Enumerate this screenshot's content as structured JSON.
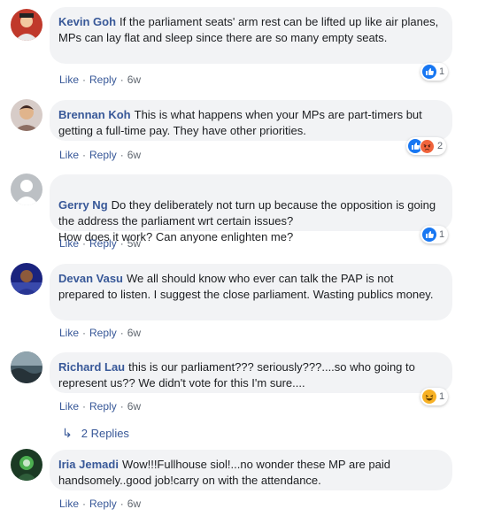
{
  "action_labels": {
    "like": "Like",
    "reply": "Reply"
  },
  "comments": [
    {
      "author": "Kevin Goh",
      "text": "If the parliament seats' arm rest can be lifted up like air planes, MPs can lay flat and sleep since there are so many empty seats.",
      "time": "6w",
      "reaction_icons": [
        "like-icon"
      ],
      "reaction_count": "1",
      "avatar_color": "#c0392b"
    },
    {
      "author": "Brennan Koh",
      "text": "This is what happens when your MPs are part-timers but getting a full-time pay. They have other priorities.",
      "time": "6w",
      "reaction_icons": [
        "like-icon",
        "angry-icon"
      ],
      "reaction_count": "2",
      "avatar_color": "#8d6e63"
    },
    {
      "author": "Gerry Ng",
      "text": "Do they deliberately not turn up because the opposition is going the address the parliament wrt certain issues?\nHow does it work? Can anyone enlighten me?",
      "time": "5w",
      "reaction_icons": [
        "like-icon"
      ],
      "reaction_count": "1",
      "avatar_color": "#bcc0c4"
    },
    {
      "author": "Devan Vasu",
      "text": "We all should know who ever can talk the PAP is not prepared to listen. I suggest the close parliament. Wasting publics money.",
      "time": "6w",
      "reaction_icons": [],
      "reaction_count": "",
      "avatar_color": "#3949ab"
    },
    {
      "author": "Richard Lau",
      "text": "this is our parliament??? seriously???....so who going to represent us?? We didn't vote for this I'm sure....",
      "time": "6w",
      "reaction_icons": [
        "haha-icon"
      ],
      "reaction_count": "1",
      "avatar_color": "#37474f"
    },
    {
      "author": "Iria Jemadi",
      "text": "Wow!!!Fullhouse siol!...no wonder these MP are paid handsomely..good job!carry on with the attendance.",
      "time": "6w",
      "reaction_icons": [],
      "reaction_count": "",
      "avatar_color": "#2e5d3a"
    }
  ],
  "replies_link": {
    "label": "2 Replies",
    "icon": "reply-arrow-icon"
  },
  "colors": {
    "author": "#385898",
    "bubble": "#f2f3f5",
    "like_blue": "#1877f2",
    "angry_orange": "#f0643c",
    "haha_yellow": "#f7b125"
  }
}
